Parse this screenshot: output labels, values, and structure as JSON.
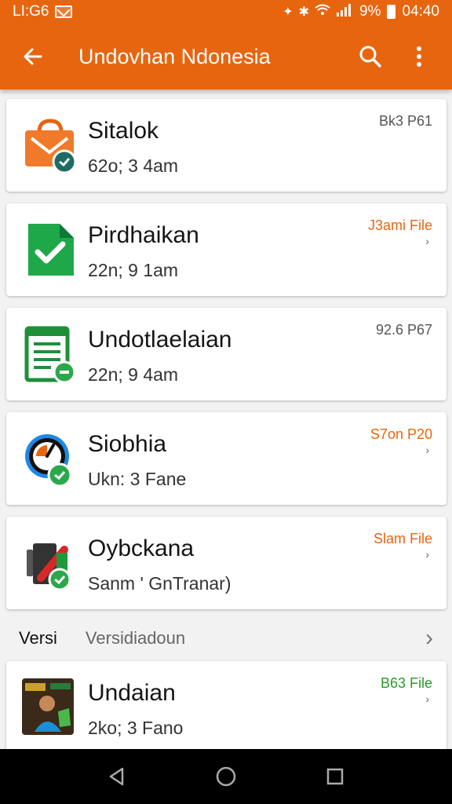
{
  "status_bar": {
    "time_left": "LI:G6",
    "battery_percent": "9%",
    "clock": "04:40",
    "icons": [
      "mail-icon",
      "vibrate-icon",
      "bluetooth-icon",
      "wifi-icon",
      "signal-icon",
      "battery-icon"
    ]
  },
  "toolbar": {
    "title": "Undovhan Ndonesia",
    "back_icon": "arrow-left-icon",
    "search_icon": "search-icon",
    "menu_icon": "more-vert-icon",
    "color": "#e8650f"
  },
  "items": [
    {
      "name": "Sitalok",
      "sub": "62o; 3 4am",
      "meta": "Bk3 P61",
      "meta_color": "#555555",
      "chevron": "",
      "icon": "shopping-bag-icon"
    },
    {
      "name": "Pirdhaikan",
      "sub": "22n; 9 1am",
      "meta": "J3ami File",
      "meta_color": "#e8650f",
      "chevron": "›",
      "icon": "document-check-icon"
    },
    {
      "name": "Undotlaelaian",
      "sub": "22n; 9 4am",
      "meta": "92.6 P67",
      "meta_color": "#555555",
      "chevron": "",
      "icon": "notepad-icon"
    },
    {
      "name": "Siobhia",
      "sub": "Ukn: 3 Fane",
      "meta": "S7on P20",
      "meta_color": "#e8650f",
      "chevron": "›",
      "icon": "clock-chart-icon"
    },
    {
      "name": "Oybckana",
      "sub": "Sanm ' GnTranar)",
      "meta": "Slam File",
      "meta_color": "#e8650f",
      "chevron": "›",
      "icon": "tools-icon"
    },
    {
      "name": "Undaian",
      "sub": "2ko; 3 Fano",
      "meta": "B63 File",
      "meta_color": "#2a9a2a",
      "chevron": "›",
      "icon": "photo-thumbnail-icon"
    }
  ],
  "section": {
    "label": "Versi",
    "value": "Versidiadoun"
  },
  "nav": {
    "back_icon": "nav-back-icon",
    "home_icon": "nav-home-icon",
    "recents_icon": "nav-recents-icon"
  }
}
